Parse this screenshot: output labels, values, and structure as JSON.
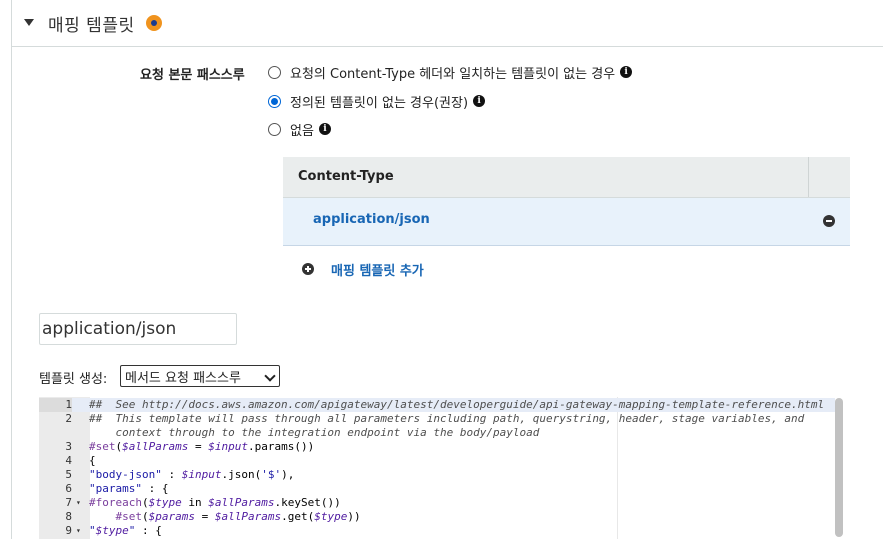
{
  "section": {
    "title": "매핑 템플릿"
  },
  "passthrough": {
    "label": "요청 본문 패스스루",
    "options": [
      {
        "label": "요청의 Content-Type 헤더와 일치하는 템플릿이 없는 경우",
        "checked": false
      },
      {
        "label": "정의된 템플릿이 없는 경우(권장)",
        "checked": true
      },
      {
        "label": "없음",
        "checked": false
      }
    ]
  },
  "content_type_table": {
    "header": "Content-Type",
    "rows": [
      "application/json"
    ]
  },
  "add_mapping": {
    "label": "매핑 템플릿 추가"
  },
  "content_type_input": {
    "value": "application/json"
  },
  "generate_template": {
    "label": "템플릿 생성:",
    "selected": "메서드 요청 패스스루"
  },
  "editor": {
    "lines": [
      {
        "num": "1",
        "fold": false,
        "text": "##  See http://docs.aws.amazon.com/apigateway/latest/developerguide/api-gateway-mapping-template-reference.html"
      },
      {
        "num": "2",
        "fold": false,
        "text": "##  This template will pass through all parameters including path, querystring, header, stage variables, and"
      },
      {
        "num": "",
        "fold": false,
        "text": "    context through to the integration endpoint via the body/payload"
      },
      {
        "num": "3",
        "fold": false,
        "text": "#set($allParams = $input.params())"
      },
      {
        "num": "4",
        "fold": false,
        "text": "{"
      },
      {
        "num": "5",
        "fold": false,
        "text": "\"body-json\" : $input.json('$'),"
      },
      {
        "num": "6",
        "fold": false,
        "text": "\"params\" : {"
      },
      {
        "num": "7",
        "fold": true,
        "text": "#foreach($type in $allParams.keySet())"
      },
      {
        "num": "8",
        "fold": false,
        "text": "    #set($params = $allParams.get($type))"
      },
      {
        "num": "9",
        "fold": true,
        "text": "\"$type\" : {"
      }
    ]
  }
}
